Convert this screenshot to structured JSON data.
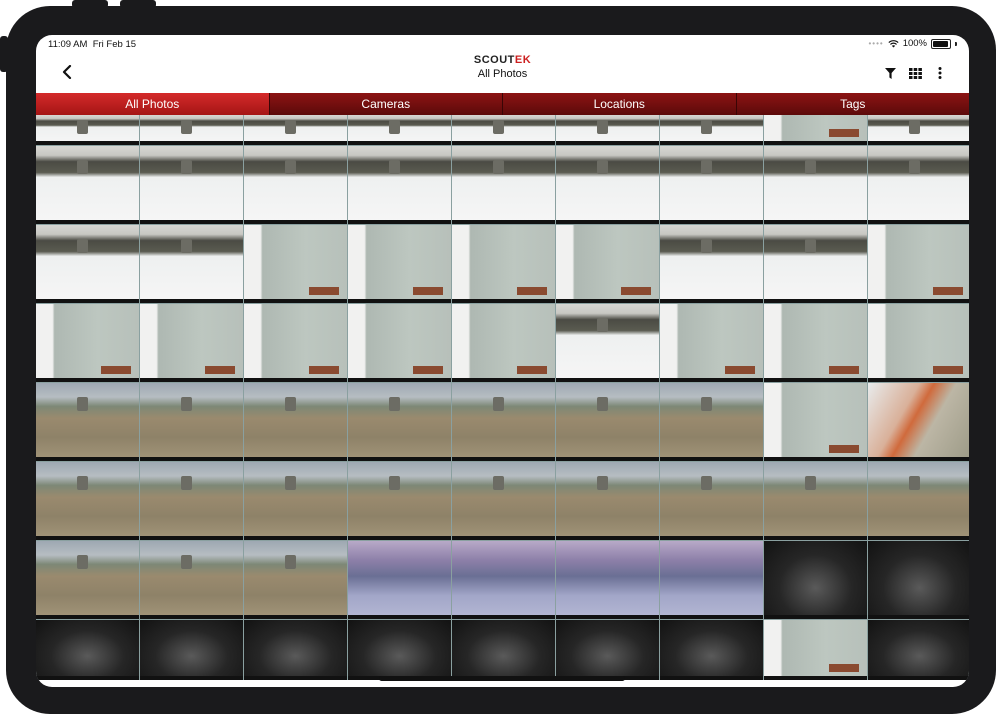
{
  "status": {
    "time": "11:09 AM",
    "date": "Fri Feb 15",
    "battery": "100%"
  },
  "header": {
    "logo_prefix": "SCOUT",
    "logo_suffix": "EK",
    "title": "All Photos",
    "back_icon": "chevron-left-icon",
    "actions": [
      "filter-icon",
      "grid-icon",
      "more-icon"
    ]
  },
  "tabs": [
    {
      "label": "All Photos",
      "active": true
    },
    {
      "label": "Cameras",
      "active": false
    },
    {
      "label": "Locations",
      "active": false
    },
    {
      "label": "Tags",
      "active": false
    }
  ],
  "colors": {
    "accent": "#cc1f1f",
    "tab_active": "#c02020",
    "tab_inactive": "#6e0e0e"
  },
  "photos": {
    "rows": [
      [
        "snow",
        "snow",
        "snow",
        "snow",
        "snow",
        "snow",
        "snow",
        "door",
        "snow"
      ],
      [
        "snow",
        "snow",
        "snow",
        "snow",
        "snow",
        "snow",
        "snow",
        "snow",
        "snow"
      ],
      [
        "snow",
        "snow",
        "door",
        "door",
        "door",
        "door",
        "snow",
        "snow",
        "door"
      ],
      [
        "door",
        "door",
        "door",
        "door",
        "door",
        "snow",
        "door",
        "door",
        "door"
      ],
      [
        "grass",
        "grass",
        "grass",
        "grass",
        "grass",
        "grass",
        "grass",
        "door",
        "orange"
      ],
      [
        "grass",
        "grass",
        "grass",
        "grass",
        "grass",
        "grass",
        "grass",
        "grass",
        "grass"
      ],
      [
        "grass",
        "grass",
        "grass",
        "dusk",
        "dusk",
        "dusk",
        "dusk",
        "night",
        "night"
      ],
      [
        "night",
        "night",
        "night",
        "night",
        "night",
        "night",
        "night",
        "door",
        "night"
      ]
    ]
  }
}
